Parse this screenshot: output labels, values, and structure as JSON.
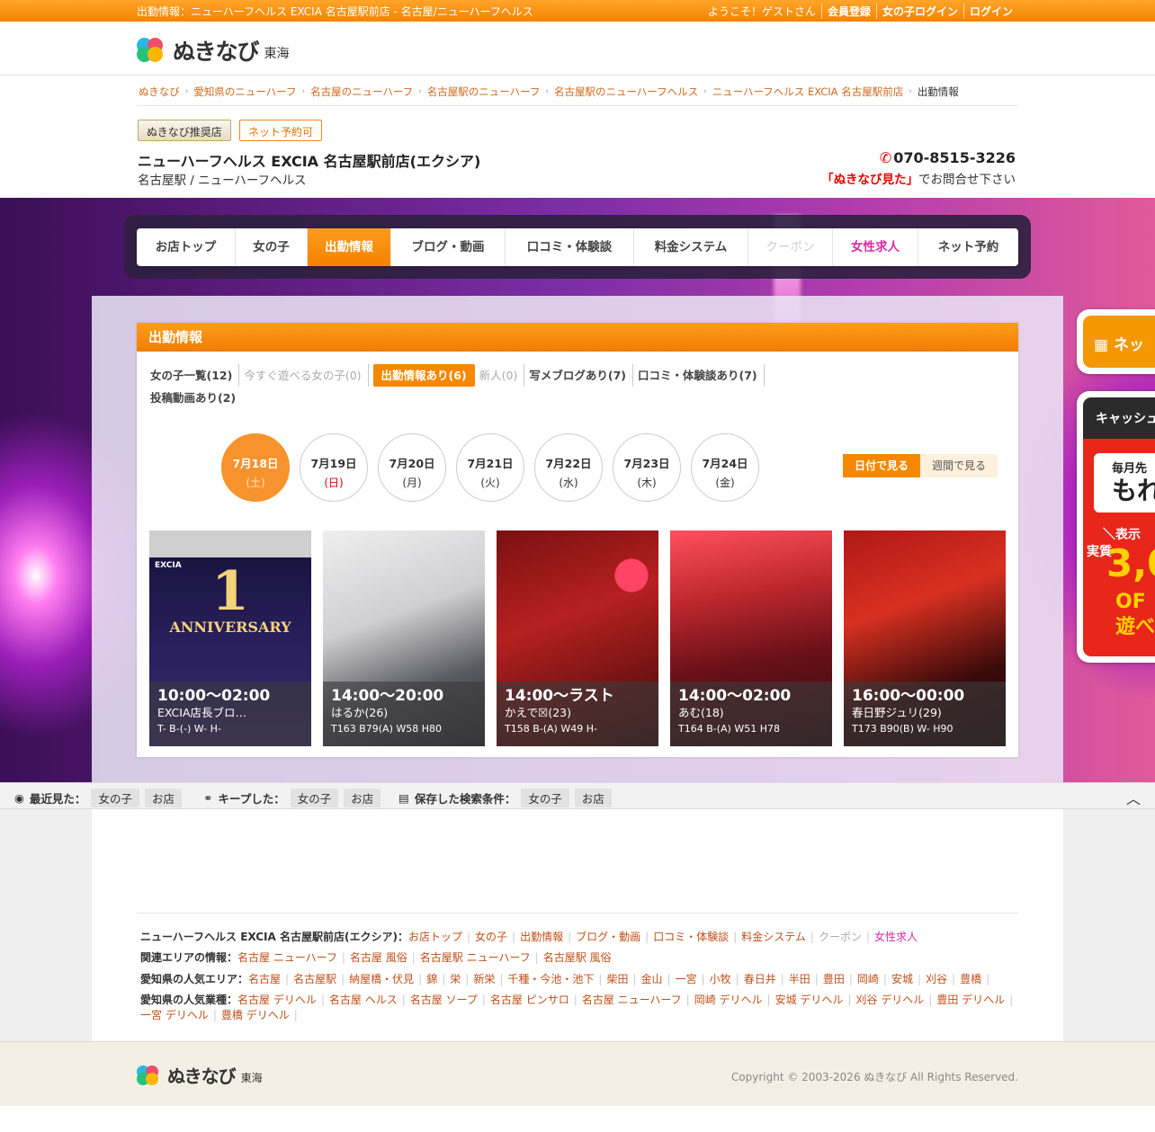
{
  "topbar": {
    "title": "出勤情報：ニューハーフヘルス EXCIA 名古屋駅前店 - 名古屋/ニューハーフヘルス",
    "welcome": "ようこそ！ゲストさん",
    "register": "会員登録",
    "girl_login": "女の子ログイン",
    "login": "ログイン"
  },
  "logo": {
    "text": "ぬきなび",
    "region": "東海"
  },
  "breadcrumb": [
    "ぬきなび",
    "愛知県のニューハーフ",
    "名古屋のニューハーフ",
    "名古屋駅のニューハーフ",
    "名古屋駅のニューハーフヘルス",
    "ニューハーフヘルス EXCIA 名古屋駅前店",
    "出勤情報"
  ],
  "badges": {
    "recommended": "ぬきなび推奨店",
    "net_reserve": "ネット予約可"
  },
  "shop": {
    "name": "ニューハーフヘルス EXCIA 名古屋駅前店(エクシア)",
    "area": "名古屋駅 / ニューハーフヘルス",
    "phone": "070-8515-3226",
    "note_highlight": "「ぬきなび見た」",
    "note_rest": "でお問合せ下さい"
  },
  "nav": [
    "お店トップ",
    "女の子",
    "出勤情報",
    "ブログ・動画",
    "口コミ・体験談",
    "料金システム",
    "クーポン",
    "女性求人",
    "ネット予約"
  ],
  "panel": {
    "title": "出勤情報",
    "filters": {
      "f1": "女の子一覧(12)",
      "f2": "今すぐ遊べる女の子(0)",
      "f3": "出勤情報あり(6)",
      "f4": "新人(0)",
      "f5": "写メブログあり(7)",
      "f6": "口コミ・体験談あり(7)",
      "f7": "投稿動画あり(2)"
    },
    "dates": [
      {
        "d": "7月18日",
        "w": "(土)"
      },
      {
        "d": "7月19日",
        "w": "(日)"
      },
      {
        "d": "7月20日",
        "w": "(月)"
      },
      {
        "d": "7月21日",
        "w": "(火)"
      },
      {
        "d": "7月22日",
        "w": "(水)"
      },
      {
        "d": "7月23日",
        "w": "(木)"
      },
      {
        "d": "7月24日",
        "w": "(金)"
      }
    ],
    "view_date": "日付で見る",
    "view_week": "週間で見る",
    "cards": [
      {
        "time": "10:00〜02:00",
        "name": "EXCIA店長ブロ…",
        "spec": "T- B-(-) W- H-",
        "banner_brand": "EXCIA",
        "banner_big": "1",
        "banner_text": "ANNIVERSARY"
      },
      {
        "time": "14:00〜20:00",
        "name": "はるか(26)",
        "spec": "T163 B79(A) W58 H80"
      },
      {
        "time": "14:00〜ラスト",
        "name": "かえで☒(23)",
        "spec": "T158 B-(A) W49 H-"
      },
      {
        "time": "14:00〜02:00",
        "name": "あむ(18)",
        "spec": "T164 B-(A) W51 H78"
      },
      {
        "time": "16:00〜00:00",
        "name": "春日野ジュリ(29)",
        "spec": "T173 B90(B) W- H90"
      }
    ]
  },
  "side": {
    "net_label": "ネッ",
    "cash_label": "キャッシュ",
    "monthly": "毎月先",
    "monthly_big": "もれ",
    "show": "＼表示",
    "real": "実質",
    "amount": "3,0",
    "tail1": "OF",
    "tail2": "遊べ"
  },
  "history": {
    "recent": "最近見た：",
    "keep": "キープした：",
    "saved": "保存した検索条件：",
    "girl": "女の子",
    "shop": "お店"
  },
  "footer_links": {
    "shop_label": "ニューハーフヘルス EXCIA 名古屋駅前店(エクシア)：",
    "shop_links": [
      "お店トップ",
      "女の子",
      "出勤情報",
      "ブログ・動画",
      "口コミ・体験談",
      "料金システム",
      "クーポン",
      "女性求人"
    ],
    "area_label": "関連エリアの情報：",
    "area_links": [
      "名古屋 ニューハーフ",
      "名古屋 風俗",
      "名古屋駅 ニューハーフ",
      "名古屋駅 風俗"
    ],
    "pop_area_label": "愛知県の人気エリア：",
    "pop_areas": [
      "名古屋",
      "名古屋駅",
      "納屋橋・伏見",
      "錦",
      "栄",
      "新栄",
      "千種・今池・池下",
      "柴田",
      "金山",
      "一宮",
      "小牧",
      "春日井",
      "半田",
      "豊田",
      "岡崎",
      "安城",
      "刈谷",
      "豊橋"
    ],
    "pop_type_label": "愛知県の人気業種：",
    "pop_types": [
      "名古屋 デリヘル",
      "名古屋 ヘルス",
      "名古屋 ソープ",
      "名古屋 ピンサロ",
      "名古屋 ニューハーフ",
      "岡崎 デリヘル",
      "安城 デリヘル",
      "刈谷 デリヘル",
      "豊田 デリヘル",
      "一宮 デリヘル",
      "豊橋 デリヘル"
    ]
  },
  "footer": {
    "copyright": "Copyright © 2003-2026 ぬきなび All Rights Reserved."
  }
}
